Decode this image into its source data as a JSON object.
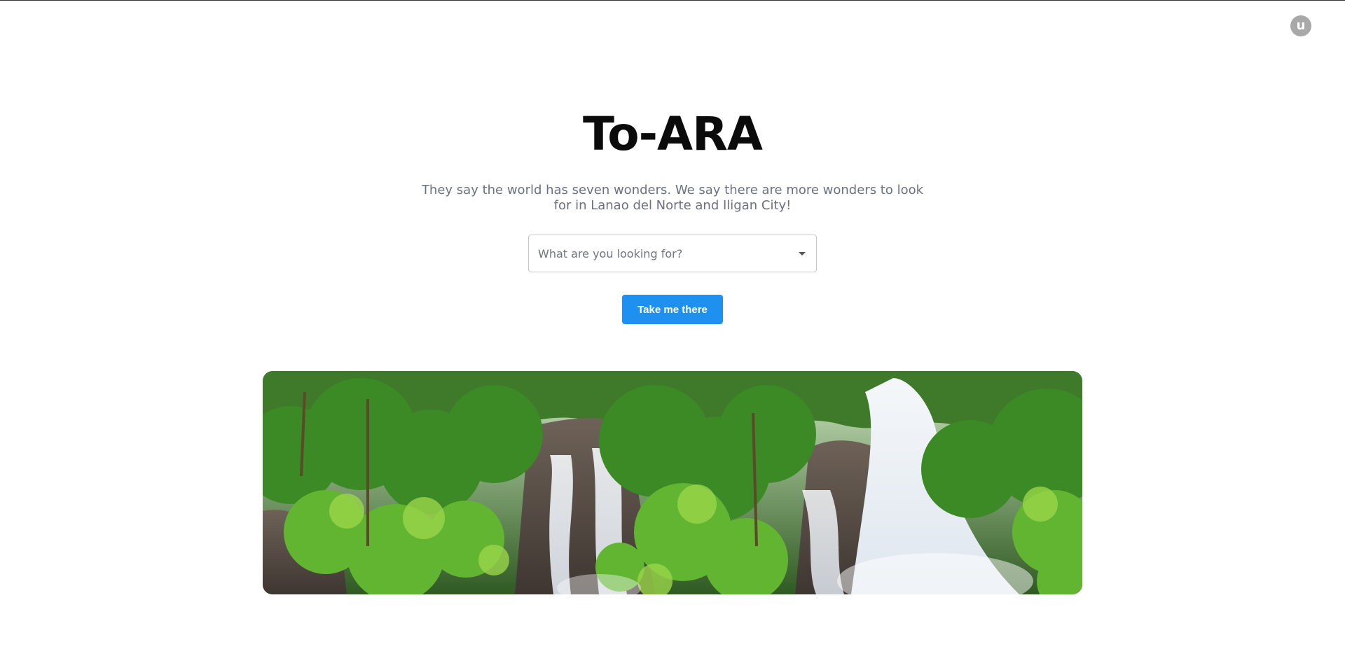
{
  "header": {
    "avatar_initial": "u"
  },
  "hero": {
    "title": "To-ARA",
    "subtitle": "They say the world has seven wonders. We say there are more wonders to look for in Lanao del Norte and Iligan City!",
    "search": {
      "placeholder": "What are you looking for?"
    },
    "cta_label": "Take me there"
  },
  "colors": {
    "accent": "#1e90f0",
    "title": "#0b0b0b",
    "subtitle": "#6b7180",
    "avatar_bg": "#a8a8a8"
  },
  "icons": {
    "dropdown": "chevron-down-icon"
  }
}
